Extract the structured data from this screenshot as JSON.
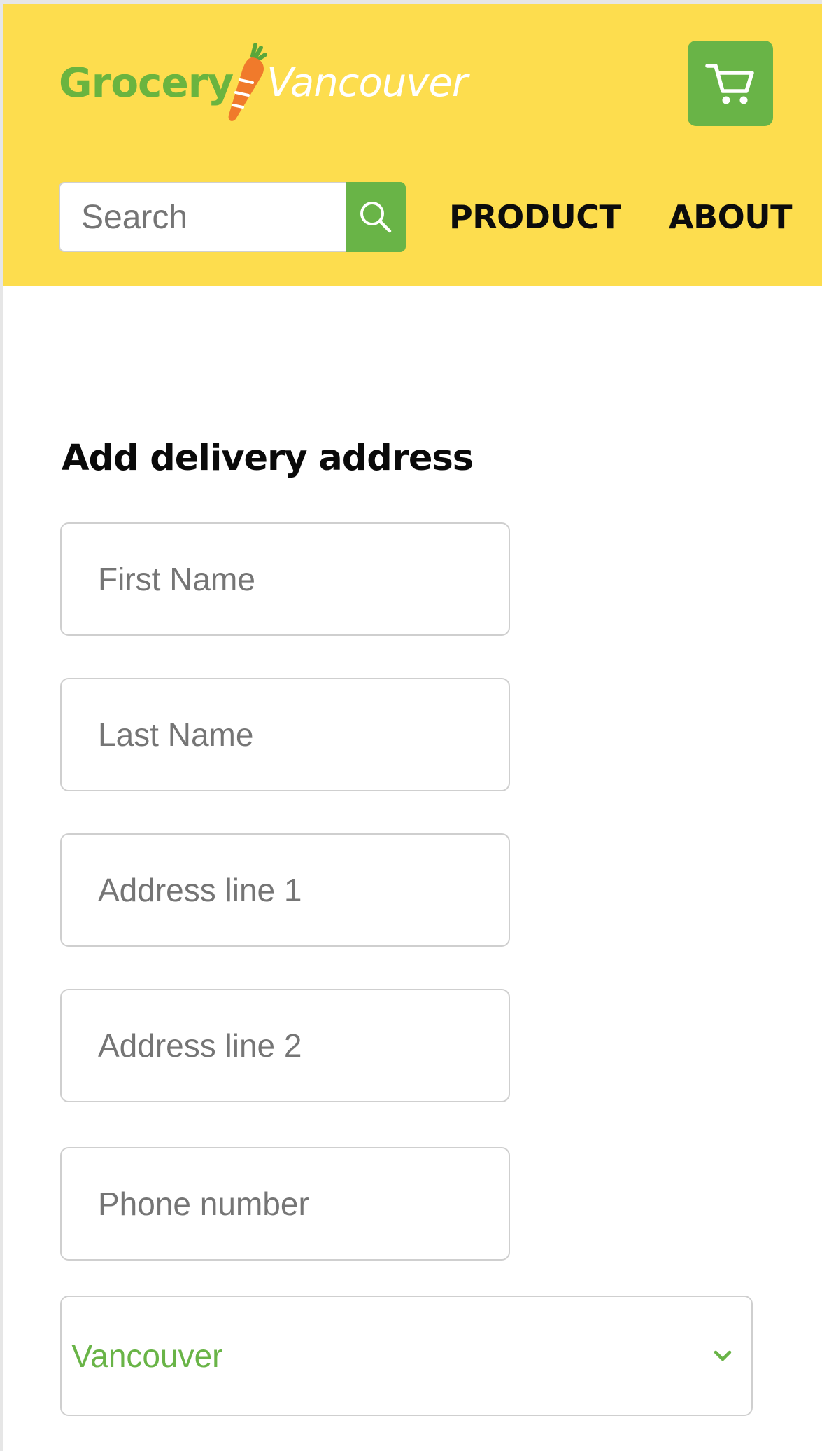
{
  "brand": {
    "name_part1": "Grocery",
    "name_part2": "Vancouver"
  },
  "header": {
    "cart_icon": "shopping-cart-icon",
    "search": {
      "placeholder": "Search",
      "icon": "search-icon"
    },
    "nav": {
      "product": "PRODUCT",
      "about": "ABOUT"
    }
  },
  "form": {
    "title": "Add delivery address",
    "fields": {
      "first_name": {
        "placeholder": "First Name",
        "value": ""
      },
      "last_name": {
        "placeholder": "Last Name",
        "value": ""
      },
      "address_line_1": {
        "placeholder": "Address line 1",
        "value": ""
      },
      "address_line_2": {
        "placeholder": "Address line 2",
        "value": ""
      },
      "phone_number": {
        "placeholder": "Phone number",
        "value": ""
      }
    },
    "city_select": {
      "selected": "Vancouver",
      "icon": "chevron-down-icon"
    }
  },
  "colors": {
    "header_background": "#fddd4e",
    "brand_green": "#69b447",
    "carrot_orange": "#f07a2b",
    "text_dark": "#0c0c0c",
    "placeholder_gray": "#757575",
    "border_gray": "#cfcfcf"
  }
}
